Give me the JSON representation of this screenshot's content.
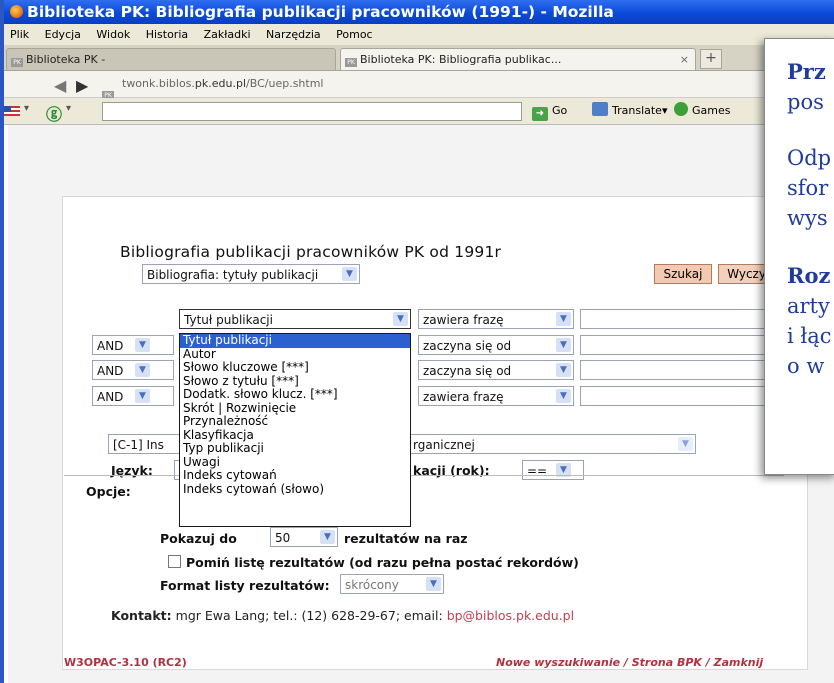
{
  "window": {
    "title": "Biblioteka PK: Bibliografia publikacji pracowników (1991-) - Mozilla"
  },
  "menu": [
    "Plik",
    "Edycja",
    "Widok",
    "Historia",
    "Zakładki",
    "Narzędzia",
    "Pomoc"
  ],
  "tabs": [
    {
      "label": "Biblioteka PK -"
    },
    {
      "label": "Biblioteka PK: Bibliografia publikac...",
      "close": "×"
    }
  ],
  "new_tab": "+",
  "address": {
    "prefix": "twonk.biblos.",
    "domain": "pk.edu.pl",
    "path": "/BC/uep.shtml"
  },
  "toolbar": {
    "go": "Go",
    "translate": "Translate",
    "games": "Games"
  },
  "page": {
    "heading": "Bibliografia publikacji pracowników PK od 1991r",
    "bib_select": "Bibliografia: tytuły publikacji",
    "search_button": "Szukaj",
    "clear_button": "Wyczyść",
    "field_select": "Tytuł publikacji",
    "ops": [
      "AND",
      "AND",
      "AND"
    ],
    "conditions": [
      "zawiera frazę",
      "zaczyna się od",
      "zaczyna się od",
      "zawiera frazę"
    ],
    "dropdown_items": [
      "Tytuł publikacji",
      "Autor",
      "Słowo kluczowe [***]",
      "Słowo z tytułu [***]",
      "Dodatk. słowo klucz. [***]",
      "Skrót | Rozwinięcie",
      "Przynależność",
      "Klasyfikacja",
      "Typ publikacji",
      "Uwagi",
      "Indeks cytowań",
      "Indeks cytowań (słowo)"
    ],
    "unit_select": "[C-1] Ins",
    "unit_select_rest": "rganicznej",
    "language_label": "Język:",
    "year_label": "kacji (rok):",
    "year_op": "==",
    "options_label": "Opcje:",
    "show_prefix": "Pokazuj do",
    "show_value": "50",
    "show_suffix": "rezultatów na raz",
    "skip_list": "Pomiń listę rezultatów (od razu pełna postać rekordów)",
    "format_label": "Format listy rezultatów:",
    "format_value": "skrócony",
    "contact_label": "Kontakt:",
    "contact_text": "mgr Ewa Lang; tel.: (12) 628-29-67; email:",
    "contact_email": "bp@biblos.pk.edu.pl",
    "version": "W3OPAC-3.10 (RC2)",
    "footer_links": "Nowe wyszukiwanie / Strona BPK / Zamknij"
  },
  "overlay": {
    "l1": "Prz",
    "l2": "pos",
    "l3": "Odp",
    "l4": "sfor",
    "l5": "wys",
    "l6": "Roz",
    "l7": "arty",
    "l8": "i łąc",
    "l9": "o w"
  }
}
